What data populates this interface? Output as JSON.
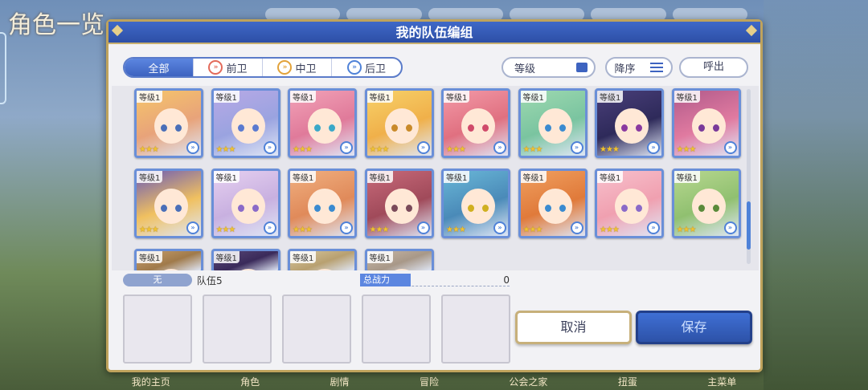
{
  "background": {
    "title": "角色一览",
    "nav": [
      "我的主页",
      "角色",
      "剧情",
      "冒险",
      "公会之家",
      "扭蛋",
      "主菜单"
    ]
  },
  "dialog": {
    "title": "我的队伍编组",
    "filters": {
      "all": "全部",
      "front": "前卫",
      "middle": "中卫",
      "back": "后卫"
    },
    "sort_label": "等级",
    "order_label": "降序",
    "call_label": "呼出",
    "characters": [
      {
        "level": "等级1",
        "stars": "★★★"
      },
      {
        "level": "等级1",
        "stars": "★★★"
      },
      {
        "level": "等级1",
        "stars": "★★★"
      },
      {
        "level": "等级1",
        "stars": "★★★"
      },
      {
        "level": "等级1",
        "stars": "★★★"
      },
      {
        "level": "等级1",
        "stars": "★★★"
      },
      {
        "level": "等级1",
        "stars": "★★★"
      },
      {
        "level": "等级1",
        "stars": "★★★"
      },
      {
        "level": "等级1",
        "stars": "★★★"
      },
      {
        "level": "等级1",
        "stars": "★★★"
      },
      {
        "level": "等级1",
        "stars": "★★★"
      },
      {
        "level": "等级1",
        "stars": "★★★"
      },
      {
        "level": "等级1",
        "stars": "★★★"
      },
      {
        "level": "等级1",
        "stars": "★★★"
      },
      {
        "level": "等级1",
        "stars": "★★★"
      },
      {
        "level": "等级1",
        "stars": "★★★"
      },
      {
        "level": "等级1",
        "stars": ""
      },
      {
        "level": "等级1",
        "stars": ""
      },
      {
        "level": "等级1",
        "stars": ""
      },
      {
        "level": "等级1",
        "stars": ""
      }
    ],
    "team": {
      "badge": "无",
      "name": "队伍5",
      "power_label": "总战力",
      "power_value": "0"
    },
    "cancel_label": "取消",
    "save_label": "保存"
  },
  "colors": {
    "header_blue": "#3f69c8",
    "frame_gold": "#bfa35c",
    "front": "#e36a5a",
    "middle": "#e2a23a",
    "back": "#4f82d8"
  }
}
